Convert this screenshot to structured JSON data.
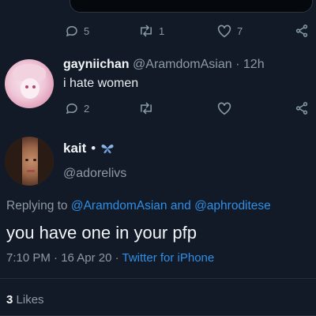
{
  "top_actions": {
    "replies": "5",
    "retweets": "1",
    "likes": "7"
  },
  "reply_tweet": {
    "display_name": "gayniichan",
    "handle": "@AramdomAsian",
    "separator": "·",
    "time": "12h",
    "text": "i hate women",
    "replies": "2"
  },
  "main_tweet": {
    "display_name": "kait",
    "bullet": "•",
    "handle": "@adorelivs",
    "replying_prefix": "Replying to",
    "replying_to_1": "@AramdomAsian",
    "replying_and": "and",
    "replying_to_2": "@aphroditese",
    "text": "you have one in your pfp",
    "time": "7:10 PM",
    "dot1": "·",
    "date": "16 Apr 20",
    "dot2": "·",
    "source": "Twitter for iPhone",
    "likes_count": "3",
    "likes_label": "Likes"
  },
  "colors": {
    "background": "#121a27",
    "link": "#2f8fe6",
    "muted": "#8d9aa5"
  }
}
